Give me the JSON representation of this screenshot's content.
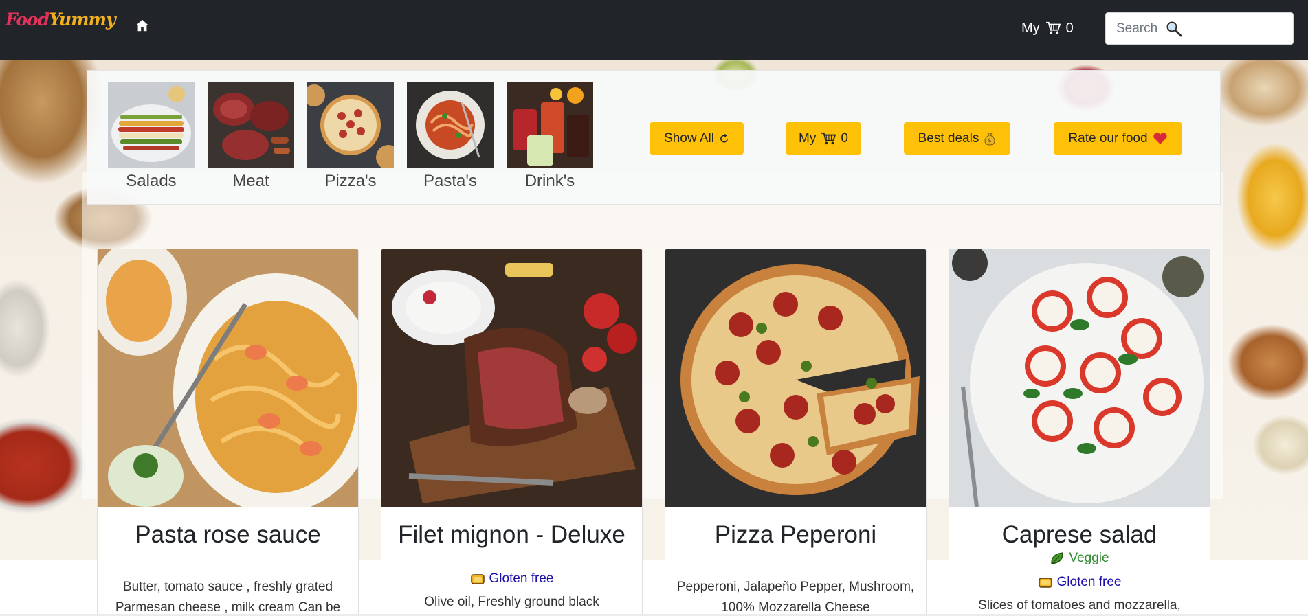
{
  "navbar": {
    "logo_part1": "Food",
    "logo_part2": "Yummy",
    "cart_label": "My",
    "cart_count": "0",
    "search_placeholder": "Search",
    "icons": [
      "home-icon",
      "cart-icon",
      "search-icon"
    ]
  },
  "categories": [
    {
      "label": "Salads",
      "icon": "salad-image"
    },
    {
      "label": "Meat",
      "icon": "meat-image"
    },
    {
      "label": "Pizza's",
      "icon": "pizza-image"
    },
    {
      "label": "Pasta's",
      "icon": "pasta-image"
    },
    {
      "label": "Drink's",
      "icon": "drinks-image"
    }
  ],
  "actions": {
    "show_all": "Show All",
    "my_cart": "My",
    "my_cart_count": "0",
    "best_deals": "Best deals",
    "rate_food": "Rate our food"
  },
  "products": [
    {
      "title": "Pasta rose sauce",
      "tags": [],
      "description": "Butter, tomato sauce , freshly grated Parmesan cheese , milk cream Can be"
    },
    {
      "title": "Filet mignon - Deluxe",
      "tags": [
        "Gloten free"
      ],
      "description": "Olive oil, Freshly ground black"
    },
    {
      "title": "Pizza Peperoni",
      "tags": [],
      "description": "Pepperoni, Jalapeño Pepper, Mushroom, 100% Mozzarella Cheese"
    },
    {
      "title": "Caprese salad",
      "tags": [
        "Veggie",
        "Gloten free"
      ],
      "description": "Slices of tomatoes and mozzarella,"
    }
  ],
  "colors": {
    "navbar_bg": "#212529",
    "accent_yellow": "#ffc107",
    "logo_red": "#e0325a",
    "logo_yellow": "#f2b01e",
    "veggie_green": "#2e8b2e",
    "gluten_link": "#1a0dab"
  }
}
